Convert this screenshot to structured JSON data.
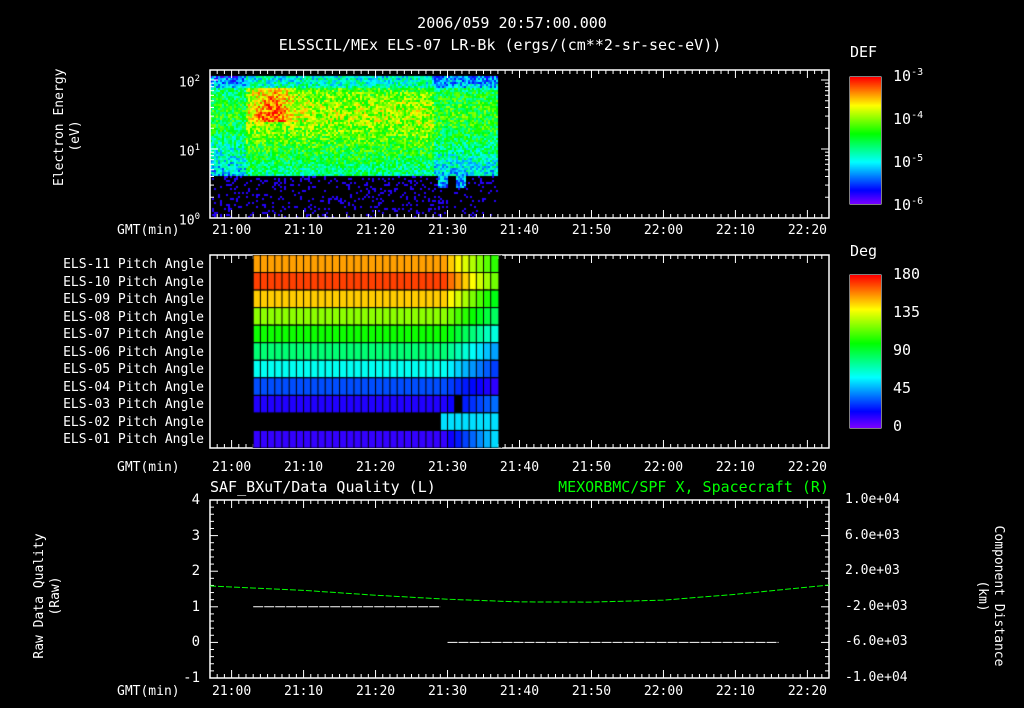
{
  "header": {
    "timestamp": "2006/059 20:57:00.000"
  },
  "time_axis": {
    "label": "GMT(min)",
    "ticks": [
      "21:00",
      "21:10",
      "21:20",
      "21:30",
      "21:40",
      "21:50",
      "22:00",
      "22:10",
      "22:20"
    ],
    "start_min": 1257,
    "end_min": 1343
  },
  "chart_data": [
    {
      "type": "heatmap",
      "title": "ELSSCIL/MEx ELS-07 LR-Bk  (ergs/(cm**2-sr-sec-eV))",
      "ylabel": "Electron Energy",
      "yunit": "(eV)",
      "yscale": "log",
      "ylim": [
        1,
        140
      ],
      "yticks": [
        {
          "base": "10",
          "exp": "0",
          "v": 1
        },
        {
          "base": "10",
          "exp": "1",
          "v": 10
        },
        {
          "base": "10",
          "exp": "2",
          "v": 100
        }
      ],
      "data_time_range": [
        "20:57",
        "21:37"
      ],
      "colorbar": {
        "label": "DEF",
        "ticks": [
          {
            "base": "10",
            "exp": "-3"
          },
          {
            "base": "10",
            "exp": "-4"
          },
          {
            "base": "10",
            "exp": "-5"
          },
          {
            "base": "10",
            "exp": "-6"
          }
        ],
        "range": [
          1e-06,
          0.001
        ]
      }
    },
    {
      "type": "heatmap",
      "title": "Pitch Angle",
      "rows": [
        {
          "label": "ELS-11 Pitch Angle",
          "start": 155,
          "end": 100
        },
        {
          "label": "ELS-10 Pitch Angle",
          "start": 170,
          "end": 110
        },
        {
          "label": "ELS-09 Pitch Angle",
          "start": 148,
          "end": 90
        },
        {
          "label": "ELS-08 Pitch Angle",
          "start": 122,
          "end": 80
        },
        {
          "label": "ELS-07 Pitch Angle",
          "start": 102,
          "end": 60
        },
        {
          "label": "ELS-06 Pitch Angle",
          "start": 82,
          "end": 40
        },
        {
          "label": "ELS-05 Pitch Angle",
          "start": 62,
          "end": 25
        },
        {
          "label": "ELS-04 Pitch Angle",
          "start": 32,
          "end": 10
        },
        {
          "label": "ELS-03 Pitch Angle",
          "start": 15,
          "end": 40
        },
        {
          "label": "ELS-02 Pitch Angle",
          "start": null,
          "end": 55
        },
        {
          "label": "ELS-01 Pitch Angle",
          "start": 12,
          "end": 60
        }
      ],
      "data_time_range": [
        "21:03",
        "21:37"
      ],
      "colorbar": {
        "label": "Deg",
        "ticks": [
          "180",
          "135",
          "90",
          "45",
          "0"
        ],
        "range": [
          0,
          180
        ]
      }
    },
    {
      "type": "line",
      "title_left": "SAF_BXuT/Data Quality (L)",
      "title_right": "MEXORBMC/SPF X, Spacecraft (R)",
      "ylabel_left": "Raw Data Quality",
      "yunit_left": "(Raw)",
      "ylim_left": [
        -1,
        4
      ],
      "yticks_left": [
        "4",
        "3",
        "2",
        "1",
        "0",
        "-1"
      ],
      "ylabel_right": "Component Distance",
      "yunit_right": "(km)",
      "ylim_right": [
        -10000,
        10000
      ],
      "yticks_right": [
        "1.0e+04",
        "6.0e+03",
        "2.0e+03",
        "-2.0e+03",
        "-6.0e+03",
        "-1.0e+04"
      ],
      "series": [
        {
          "name": "Data Quality",
          "color": "#ffffff",
          "segments": [
            {
              "t": [
                "21:03",
                "21:29"
              ],
              "v": 1
            },
            {
              "t": [
                "21:30",
                "22:16"
              ],
              "v": 0
            }
          ]
        },
        {
          "name": "SPF X",
          "color": "#00ff00",
          "t": [
            "20:57",
            "21:10",
            "21:20",
            "21:30",
            "21:40",
            "21:50",
            "22:00",
            "22:10",
            "22:23"
          ],
          "v": [
            340,
            -150,
            -700,
            -1150,
            -1450,
            -1470,
            -1250,
            -600,
            450
          ]
        }
      ]
    }
  ]
}
